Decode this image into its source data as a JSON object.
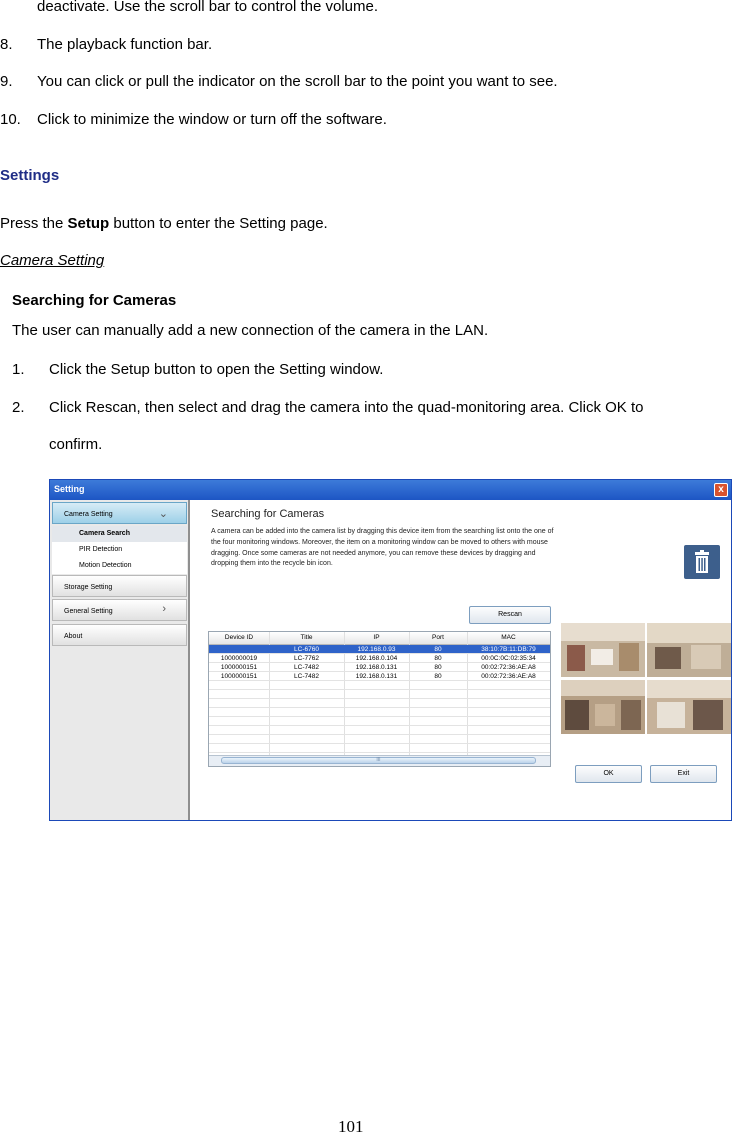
{
  "doc": {
    "lines": [
      "deactivate. Use the scroll bar to control the volume.",
      "The playback function bar.",
      "You can click or pull the indicator on the scroll bar to the point you want to see.",
      "Click to minimize the window or turn off the software."
    ],
    "numbers": [
      "8.",
      "9.",
      "10."
    ],
    "settings_heading": "Settings",
    "press_prefix": "Press the ",
    "press_bold": "Setup",
    "press_suffix": " button to enter the Setting page.",
    "camera_setting": "Camera Setting",
    "searching_heading": "Searching for Cameras",
    "intro": "The user can manually add a new connection of the camera in the LAN.",
    "step1_num": "1.",
    "step1": "Click the Setup button to open the Setting window.",
    "step2_num": "2.",
    "step2": "Click Rescan, then select and drag the camera into the quad-monitoring area. Click OK to",
    "step2_cont": "confirm.",
    "page_number": "101"
  },
  "window": {
    "title": "Setting",
    "close_glyph": "x",
    "nav": {
      "camera_setting": "Camera Setting",
      "camera_search": "Camera Search",
      "pir_detection": "PIR Detection",
      "motion_detection": "Motion Detection",
      "storage_setting": "Storage Setting",
      "general_setting": "General Setting",
      "about": "About"
    },
    "panel_title": "Searching for Cameras",
    "panel_desc": "A camera can be added into the camera list by dragging this device item from the searching list onto the one of the four monitoring windows. Moreover, the item on a monitoring window can be moved to others with mouse dragging. Once some cameras are not needed anymore, you can remove these devices by dragging and dropping them into the recycle bin icon.",
    "rescan": "Rescan",
    "ok": "OK",
    "exit": "Exit",
    "table": {
      "headers": [
        "Device ID",
        "Title",
        "IP",
        "Port",
        "MAC"
      ],
      "rows": [
        [
          "",
          "LC-6760",
          "192.168.0.93",
          "80",
          "38:10:7B:11:DB:79"
        ],
        [
          "1000000019",
          "LC-7762",
          "192.168.0.104",
          "80",
          "00:0C:0C:02:35:34"
        ],
        [
          "1000000151",
          "LC-7482",
          "192.168.0.131",
          "80",
          "00:02:72:36:AE:A8"
        ],
        [
          "1000000151",
          "LC-7482",
          "192.168.0.131",
          "80",
          "00:02:72:36:AE:A8"
        ]
      ],
      "scroll_glyph": "III"
    }
  }
}
